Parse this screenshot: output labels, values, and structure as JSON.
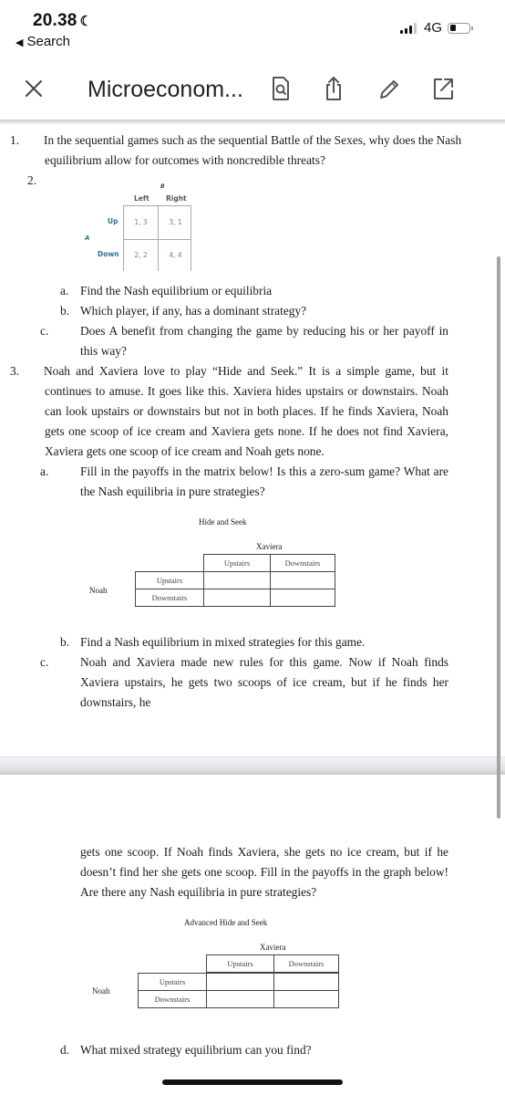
{
  "status_bar": {
    "time": "20.38",
    "focus_icon": "moon-icon",
    "back_label": "Search",
    "network": "4G",
    "battery_level_percent": 20
  },
  "toolbar": {
    "title": "Microeconom...",
    "icons": [
      "close-icon",
      "search-document-icon",
      "share-icon",
      "pencil-icon",
      "open-external-icon"
    ]
  },
  "document": {
    "q1": {
      "number": "1.",
      "text": "In the sequential games such as the sequential Battle of the Sexes, why does the Nash equilibrium allow for outcomes with noncredible threats?"
    },
    "q2": {
      "number": "2.",
      "matrix": {
        "col_player": "B",
        "row_player": "A",
        "columns": [
          "Left",
          "Right"
        ],
        "rows": [
          "Up",
          "Down"
        ],
        "cells": [
          [
            "1, 3",
            "3, 1"
          ],
          [
            "2, 2",
            "4, 4"
          ]
        ]
      },
      "parts": [
        {
          "label": "a.",
          "text": "Find the Nash equilibrium or equilibria"
        },
        {
          "label": "b.",
          "text": "Which player, if any, has a dominant strategy?"
        },
        {
          "label": "c.",
          "text": "Does A benefit from changing the game by reducing his or her payoff in this way?"
        }
      ]
    },
    "q3": {
      "number": "3.",
      "text": "Noah and Xaviera love to play “Hide and Seek.” It is a simple game, but it continues to amuse. It goes like this. Xaviera hides upstairs or downstairs. Noah can look upstairs or downstairs but not in both places. If he finds Xaviera, Noah gets one scoop of ice cream and Xaviera gets none. If he does not find Xaviera, Xaviera gets one scoop of ice cream and Noah gets none.",
      "part_a": {
        "label": "a.",
        "text": "Fill in the payoffs in the matrix below! Is this a zero-sum game? What are the Nash equilibria in pure strategies?"
      },
      "matrix1": {
        "title": "Hide and Seek",
        "col_player": "Xaviera",
        "row_player": "Noah",
        "columns": [
          "Upstairs",
          "Downstairs"
        ],
        "rows": [
          "Upstairs",
          "Downstairs"
        ],
        "cells": [
          [
            "",
            ""
          ],
          [
            "",
            ""
          ]
        ]
      },
      "part_b": {
        "label": "b.",
        "text": "Find a Nash equilibrium in mixed strategies for this game."
      },
      "part_c": {
        "label": "c.",
        "text_page1": "Noah and Xaviera made new rules for this game. Now if Noah finds Xaviera upstairs, he gets two scoops of ice cream, but if he finds her downstairs, he",
        "text_page2": "gets one scoop. If Noah finds Xaviera, she gets no ice cream, but if he doesn’t find her she gets one scoop. Fill in the payoffs in the graph below! Are there any Nash equilibria in pure strategies?"
      },
      "matrix2": {
        "title": "Advanced Hide and Seek",
        "col_player": "Xaviera",
        "row_player": "Noah",
        "columns": [
          "Upstairs",
          "Downstairs"
        ],
        "rows": [
          "Upstairs",
          "Downstairs"
        ],
        "cells": [
          [
            "",
            ""
          ],
          [
            "",
            ""
          ]
        ]
      },
      "part_d": {
        "label": "d.",
        "text": "What mixed strategy equilibrium can you find?"
      }
    }
  }
}
